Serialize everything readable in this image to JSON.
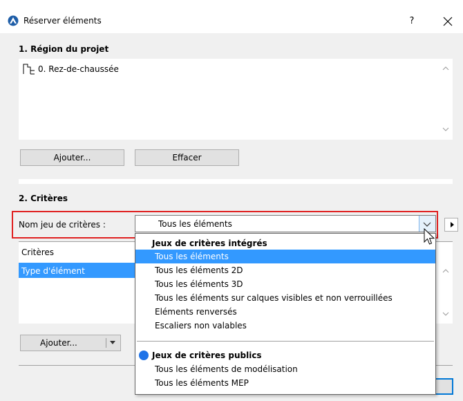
{
  "window": {
    "title": "Réserver éléments",
    "help_label": "?",
    "icons": {
      "app": "archicad-logo-icon",
      "close": "close-icon"
    }
  },
  "region": {
    "section_title": "1. Région du projet",
    "items": [
      {
        "label": "0. Rez-de-chaussée",
        "icon": "story-floor-icon"
      }
    ],
    "add_button": "Ajouter...",
    "clear_button": "Effacer"
  },
  "criteria": {
    "section_title": "2. Critères",
    "set_label": "Nom jeu de critères :",
    "set_value": "Tous les éléments",
    "list_header": "Critères",
    "rows": [
      "Type d'élément"
    ],
    "add_button": "Ajouter..."
  },
  "dropdown": {
    "groups": [
      {
        "title": "Jeux de critères intégrés",
        "items": [
          "Tous les éléments",
          "Tous les éléments 2D",
          "Tous les éléments 3D",
          "Tous les éléments sur calques visibles et non verrouillées",
          "Eléments renversés",
          "Escaliers non valables"
        ],
        "selected_index": 0
      },
      {
        "title": "Jeux de critères publics",
        "icon": "public-dot-icon",
        "items": [
          "Tous les éléments de modélisation",
          "Tous les éléments MEP"
        ]
      }
    ]
  },
  "colors": {
    "selection": "#3399ff",
    "highlight_border": "#e02020",
    "focus_border": "#0078d7",
    "public_dot": "#1e73e8"
  }
}
